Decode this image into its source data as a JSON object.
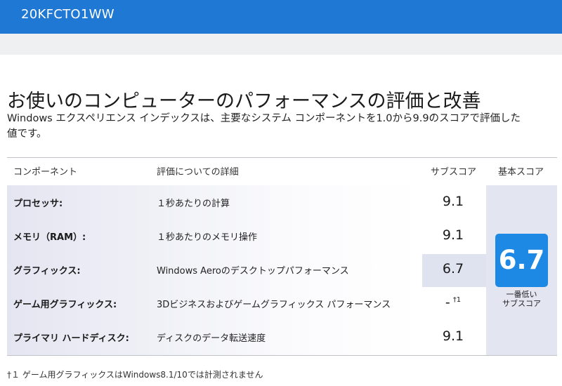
{
  "window": {
    "title": "20KFCTO1WW"
  },
  "page": {
    "title": "お使いのコンピューターのパフォーマンスの評価と改善",
    "description_line1": "Windows エクスペリエンス インデックスは、主要なシステム コンポーネントを1.0から9.9のスコアで評価した",
    "description_line2": "値です。"
  },
  "table": {
    "headers": {
      "component": "コンポーネント",
      "detail": "評価についての詳細",
      "subscore": "サブスコア",
      "base_score": "基本スコア"
    },
    "rows": [
      {
        "component": "プロセッサ:",
        "detail": "１秒あたりの計算",
        "subscore": "9.1",
        "mark": ""
      },
      {
        "component": "メモリ（RAM）:",
        "detail": "１秒あたりのメモリ操作",
        "subscore": "9.1",
        "mark": ""
      },
      {
        "component": "グラフィックス:",
        "detail": "Windows Aeroのデスクトップパフォーマンス",
        "subscore": "6.7",
        "mark": ""
      },
      {
        "component": "ゲーム用グラフィックス:",
        "detail": "3Dビジネスおよびゲームグラフィックス パフォーマンス",
        "subscore": "-",
        "mark": "†1"
      },
      {
        "component": "プライマリ ハードディスク:",
        "detail": "ディスクのデータ転送速度",
        "subscore": "9.1",
        "mark": ""
      }
    ],
    "base_score": {
      "value": "6.7",
      "caption_line1": "一番低い",
      "caption_line2": "サブスコア"
    }
  },
  "footnote": "†１ ゲーム用グラフィックスはWindows8.1/10では計測されません",
  "colors": {
    "titlebar": "#1e78d4",
    "base_score_box": "#1e88e5",
    "base_column": "#e3e5f0",
    "lowest_highlight": "#dfe3f0"
  }
}
